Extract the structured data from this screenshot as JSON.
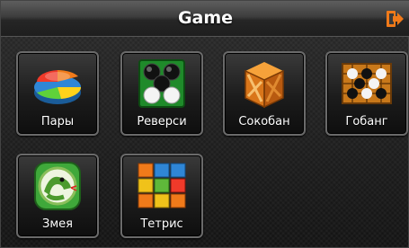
{
  "header": {
    "title": "Game"
  },
  "icons": {
    "exit": "exit-icon"
  },
  "games": [
    {
      "label": "Пары",
      "icon": "pie-chart-icon"
    },
    {
      "label": "Реверси",
      "icon": "reversi-icon"
    },
    {
      "label": "Сокобан",
      "icon": "crate-icon"
    },
    {
      "label": "Гобанг",
      "icon": "gobang-icon"
    },
    {
      "label": "Змея",
      "icon": "snake-icon"
    },
    {
      "label": "Тетрис",
      "icon": "tetris-icon"
    }
  ],
  "colors": {
    "accent": "#f07a1a",
    "text": "#ffffff"
  }
}
